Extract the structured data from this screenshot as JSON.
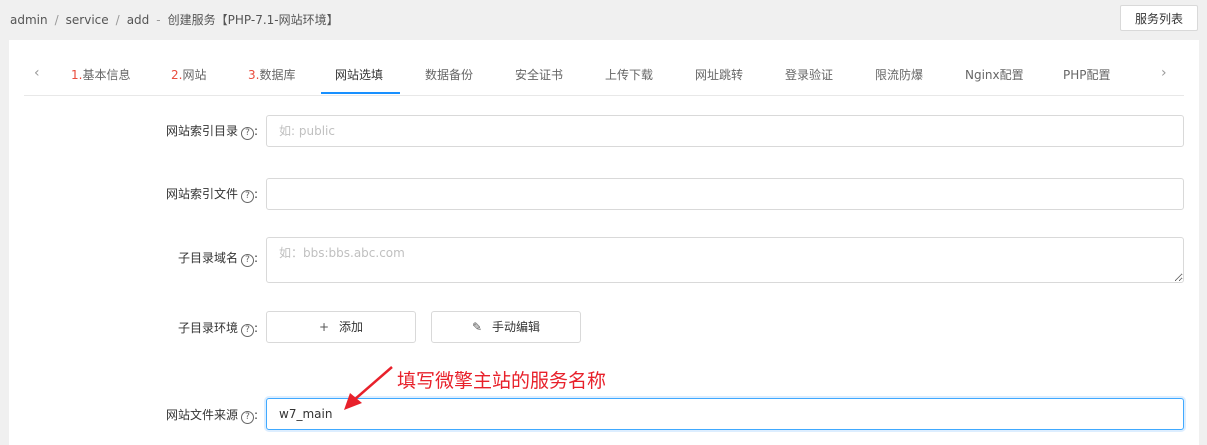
{
  "breadcrumb": {
    "items": [
      "admin",
      "service",
      "add"
    ],
    "current": "创建服务【PHP-7.1-网站环境】"
  },
  "header": {
    "list_button": "服务列表"
  },
  "tabs": {
    "items": [
      {
        "num": "1.",
        "label": "基本信息"
      },
      {
        "num": "2.",
        "label": "网站"
      },
      {
        "num": "3.",
        "label": "数据库"
      },
      {
        "num": "",
        "label": "网站选填"
      },
      {
        "num": "",
        "label": "数据备份"
      },
      {
        "num": "",
        "label": "安全证书"
      },
      {
        "num": "",
        "label": "上传下载"
      },
      {
        "num": "",
        "label": "网址跳转"
      },
      {
        "num": "",
        "label": "登录验证"
      },
      {
        "num": "",
        "label": "限流防爆"
      },
      {
        "num": "",
        "label": "Nginx配置"
      },
      {
        "num": "",
        "label": "PHP配置"
      }
    ],
    "active": "网站选填"
  },
  "form": {
    "index_dir": {
      "label": "网站索引目录",
      "placeholder": "如: public",
      "value": ""
    },
    "index_file": {
      "label": "网站索引文件",
      "placeholder": "",
      "value": ""
    },
    "subdomain": {
      "label": "子目录域名",
      "placeholder": "如：bbs:bbs.abc.com",
      "value": ""
    },
    "subdir_env": {
      "label": "子目录环境",
      "add_button": "添加",
      "manual_button": "手动编辑"
    },
    "source": {
      "label": "网站文件来源",
      "value": "w7_main"
    }
  },
  "annotation": {
    "text": "填写微擎主站的服务名称",
    "color": "#e8212b"
  },
  "colors": {
    "accent": "#1890ff",
    "tab_number": "#e94c3d"
  }
}
